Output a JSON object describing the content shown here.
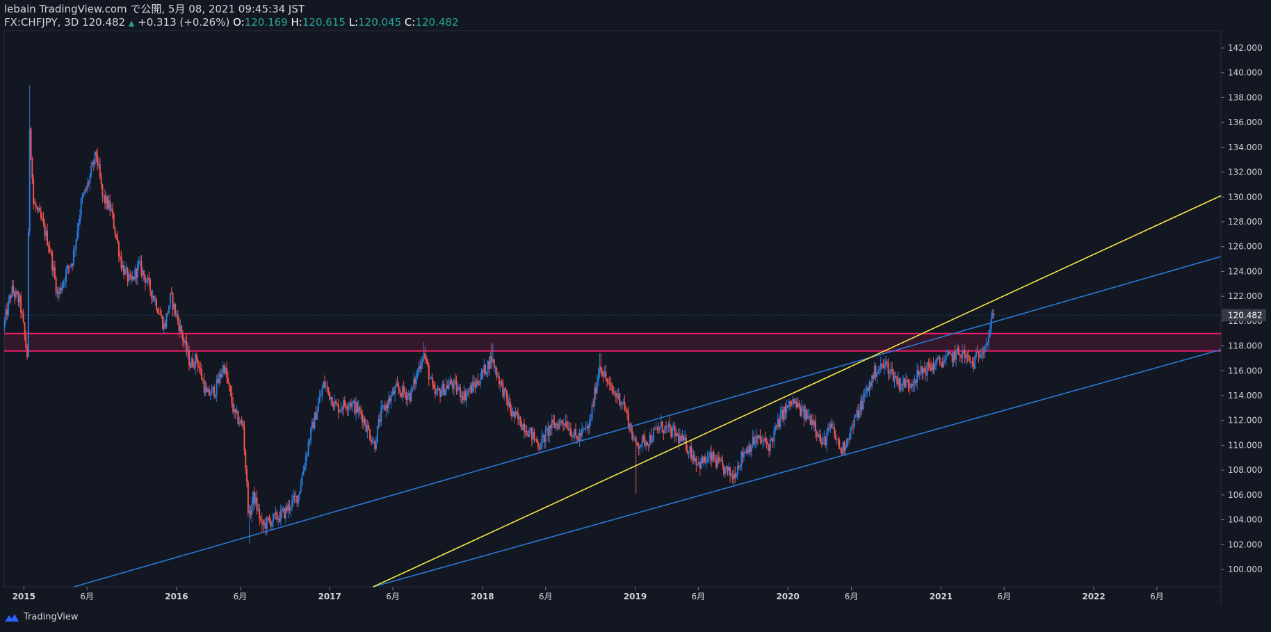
{
  "header": {
    "line1": "lebain TradingView.com で公開, 5月 08, 2021 09:45:34 JST",
    "symbol": "FX:CHFJPY, 3D",
    "price": "120.482",
    "change_arrow": "▲",
    "change": "+0.313 (+0.26%)",
    "o_label": "O:",
    "o_value": "120.169",
    "h_label": "H:",
    "h_value": "120.615",
    "l_label": "L:",
    "l_value": "120.045",
    "c_label": "C:",
    "c_value": "120.482"
  },
  "footer": {
    "brand": "TradingView",
    "logo_icon": "tradingview-logo-icon"
  },
  "colors": {
    "background": "#131722",
    "up": "#2979d8",
    "down": "#ef5350",
    "zone": "#e91e63",
    "channel": "#2979d8",
    "trend": "#f5e847",
    "axis_text": "#d1d4dc",
    "price_tag": "#363a45"
  },
  "chart_data": {
    "type": "candlestick",
    "symbol": "FX:CHFJPY",
    "timeframe": "3D",
    "x_range": [
      "2014-11-15",
      "2022-11-01"
    ],
    "y_range": [
      98.6,
      143.4
    ],
    "y_ticks": [
      100,
      102,
      104,
      106,
      108,
      110,
      112,
      114,
      116,
      118,
      120,
      122,
      124,
      126,
      128,
      130,
      132,
      134,
      136,
      138,
      140,
      142
    ],
    "y_tick_labels": [
      "100.000",
      "102.000",
      "104.000",
      "106.000",
      "108.000",
      "110.000",
      "112.000",
      "114.000",
      "116.000",
      "118.000",
      "120.000",
      "122.000",
      "124.000",
      "126.000",
      "128.000",
      "130.000",
      "132.000",
      "134.000",
      "136.000",
      "138.000",
      "140.000",
      "142.000"
    ],
    "x_ticks": [
      {
        "date": "2015-01-01",
        "label": "2015",
        "major": true
      },
      {
        "date": "2015-06-01",
        "label": "6月",
        "major": false
      },
      {
        "date": "2016-01-01",
        "label": "2016",
        "major": true
      },
      {
        "date": "2016-06-01",
        "label": "6月",
        "major": false
      },
      {
        "date": "2017-01-01",
        "label": "2017",
        "major": true
      },
      {
        "date": "2017-06-01",
        "label": "6月",
        "major": false
      },
      {
        "date": "2018-01-01",
        "label": "2018",
        "major": true
      },
      {
        "date": "2018-06-01",
        "label": "6月",
        "major": false
      },
      {
        "date": "2019-01-01",
        "label": "2019",
        "major": true
      },
      {
        "date": "2019-06-01",
        "label": "6月",
        "major": false
      },
      {
        "date": "2020-01-01",
        "label": "2020",
        "major": true
      },
      {
        "date": "2020-06-01",
        "label": "6月",
        "major": false
      },
      {
        "date": "2021-01-01",
        "label": "2021",
        "major": true
      },
      {
        "date": "2021-06-01",
        "label": "6月",
        "major": false
      },
      {
        "date": "2022-01-01",
        "label": "2022",
        "major": true
      },
      {
        "date": "2022-06-01",
        "label": "6月",
        "major": false
      }
    ],
    "price_path": [
      [
        "2014-11-15",
        119.5
      ],
      [
        "2014-12-05",
        122.5
      ],
      [
        "2014-12-25",
        121.5
      ],
      [
        "2015-01-12",
        117.0
      ],
      [
        "2015-01-16",
        136.5
      ],
      [
        "2015-01-26",
        129.5
      ],
      [
        "2015-02-15",
        128.0
      ],
      [
        "2015-03-05",
        126.0
      ],
      [
        "2015-03-25",
        122.0
      ],
      [
        "2015-04-15",
        124.0
      ],
      [
        "2015-04-30",
        125.0
      ],
      [
        "2015-05-20",
        129.5
      ],
      [
        "2015-06-05",
        131.0
      ],
      [
        "2015-06-25",
        133.5
      ],
      [
        "2015-07-10",
        130.0
      ],
      [
        "2015-07-30",
        129.0
      ],
      [
        "2015-08-25",
        124.5
      ],
      [
        "2015-09-15",
        123.0
      ],
      [
        "2015-10-05",
        124.5
      ],
      [
        "2015-10-20",
        123.5
      ],
      [
        "2015-11-15",
        121.5
      ],
      [
        "2015-12-05",
        119.5
      ],
      [
        "2015-12-20",
        122.0
      ],
      [
        "2016-01-15",
        119.0
      ],
      [
        "2016-02-05",
        116.5
      ],
      [
        "2016-02-20",
        117.0
      ],
      [
        "2016-03-15",
        114.0
      ],
      [
        "2016-04-05",
        114.5
      ],
      [
        "2016-04-25",
        116.5
      ],
      [
        "2016-05-20",
        112.5
      ],
      [
        "2016-06-10",
        111.5
      ],
      [
        "2016-06-24",
        104.0
      ],
      [
        "2016-07-05",
        106.0
      ],
      [
        "2016-07-25",
        103.5
      ],
      [
        "2016-08-20",
        104.0
      ],
      [
        "2016-09-15",
        104.5
      ],
      [
        "2016-10-20",
        106.0
      ],
      [
        "2016-11-15",
        110.5
      ],
      [
        "2016-12-20",
        115.0
      ],
      [
        "2017-01-20",
        113.0
      ],
      [
        "2017-02-20",
        113.5
      ],
      [
        "2017-03-20",
        112.5
      ],
      [
        "2017-04-20",
        110.0
      ],
      [
        "2017-05-05",
        112.5
      ],
      [
        "2017-06-10",
        114.5
      ],
      [
        "2017-07-15",
        114.0
      ],
      [
        "2017-08-15",
        117.5
      ],
      [
        "2017-09-10",
        114.0
      ],
      [
        "2017-10-20",
        115.0
      ],
      [
        "2017-11-20",
        114.0
      ],
      [
        "2017-12-20",
        115.0
      ],
      [
        "2018-01-25",
        117.0
      ],
      [
        "2018-02-15",
        115.0
      ],
      [
        "2018-03-15",
        112.5
      ],
      [
        "2018-04-15",
        111.5
      ],
      [
        "2018-05-20",
        110.0
      ],
      [
        "2018-06-15",
        111.5
      ],
      [
        "2018-07-20",
        112.0
      ],
      [
        "2018-08-15",
        110.5
      ],
      [
        "2018-09-15",
        111.5
      ],
      [
        "2018-10-10",
        116.5
      ],
      [
        "2018-11-05",
        114.5
      ],
      [
        "2018-12-05",
        113.5
      ],
      [
        "2019-01-03",
        110.0
      ],
      [
        "2019-02-05",
        110.5
      ],
      [
        "2019-03-05",
        111.5
      ],
      [
        "2019-04-05",
        111.0
      ],
      [
        "2019-05-05",
        110.0
      ],
      [
        "2019-06-05",
        108.5
      ],
      [
        "2019-07-05",
        109.0
      ],
      [
        "2019-08-05",
        108.0
      ],
      [
        "2019-08-25",
        107.5
      ],
      [
        "2019-09-20",
        109.5
      ],
      [
        "2019-10-20",
        110.5
      ],
      [
        "2019-11-20",
        110.0
      ],
      [
        "2019-12-20",
        112.5
      ],
      [
        "2020-01-15",
        113.5
      ],
      [
        "2020-02-10",
        112.5
      ],
      [
        "2020-03-05",
        112.0
      ],
      [
        "2020-03-25",
        110.0
      ],
      [
        "2020-04-15",
        111.5
      ],
      [
        "2020-05-10",
        109.5
      ],
      [
        "2020-06-05",
        111.5
      ],
      [
        "2020-07-05",
        114.0
      ],
      [
        "2020-07-30",
        116.0
      ],
      [
        "2020-08-25",
        116.5
      ],
      [
        "2020-09-25",
        115.0
      ],
      [
        "2020-10-20",
        115.0
      ],
      [
        "2020-11-20",
        116.0
      ],
      [
        "2020-12-20",
        116.5
      ],
      [
        "2021-01-20",
        117.0
      ],
      [
        "2021-02-20",
        117.5
      ],
      [
        "2021-03-20",
        116.5
      ],
      [
        "2021-04-10",
        117.8
      ],
      [
        "2021-04-25",
        118.5
      ],
      [
        "2021-05-07",
        120.482
      ]
    ],
    "extremes": [
      [
        "2015-01-16",
        139.0
      ],
      [
        "2015-06-25",
        133.8
      ],
      [
        "2016-06-24",
        102.1
      ],
      [
        "2016-07-25",
        103.0
      ],
      [
        "2017-08-15",
        118.3
      ],
      [
        "2018-01-25",
        118.2
      ],
      [
        "2018-10-10",
        117.4
      ],
      [
        "2019-01-03",
        106.1
      ],
      [
        "2019-08-25",
        106.8
      ],
      [
        "2020-05-10",
        109.2
      ],
      [
        "2021-05-07",
        120.615
      ]
    ],
    "last_price": "120.482",
    "zone": {
      "top": 119.0,
      "bottom": 117.6
    },
    "trend_lines": [
      {
        "kind": "channel-upper",
        "from": [
          "2015-05-01",
          98.6
        ],
        "to": [
          "2022-11-01",
          125.2
        ]
      },
      {
        "kind": "channel-lower",
        "from": [
          "2017-04-15",
          98.6
        ],
        "to": [
          "2022-11-01",
          117.7
        ]
      },
      {
        "kind": "yellow-trend",
        "from": [
          "2017-04-15",
          98.6
        ],
        "to": [
          "2022-11-01",
          130.1
        ]
      }
    ]
  }
}
